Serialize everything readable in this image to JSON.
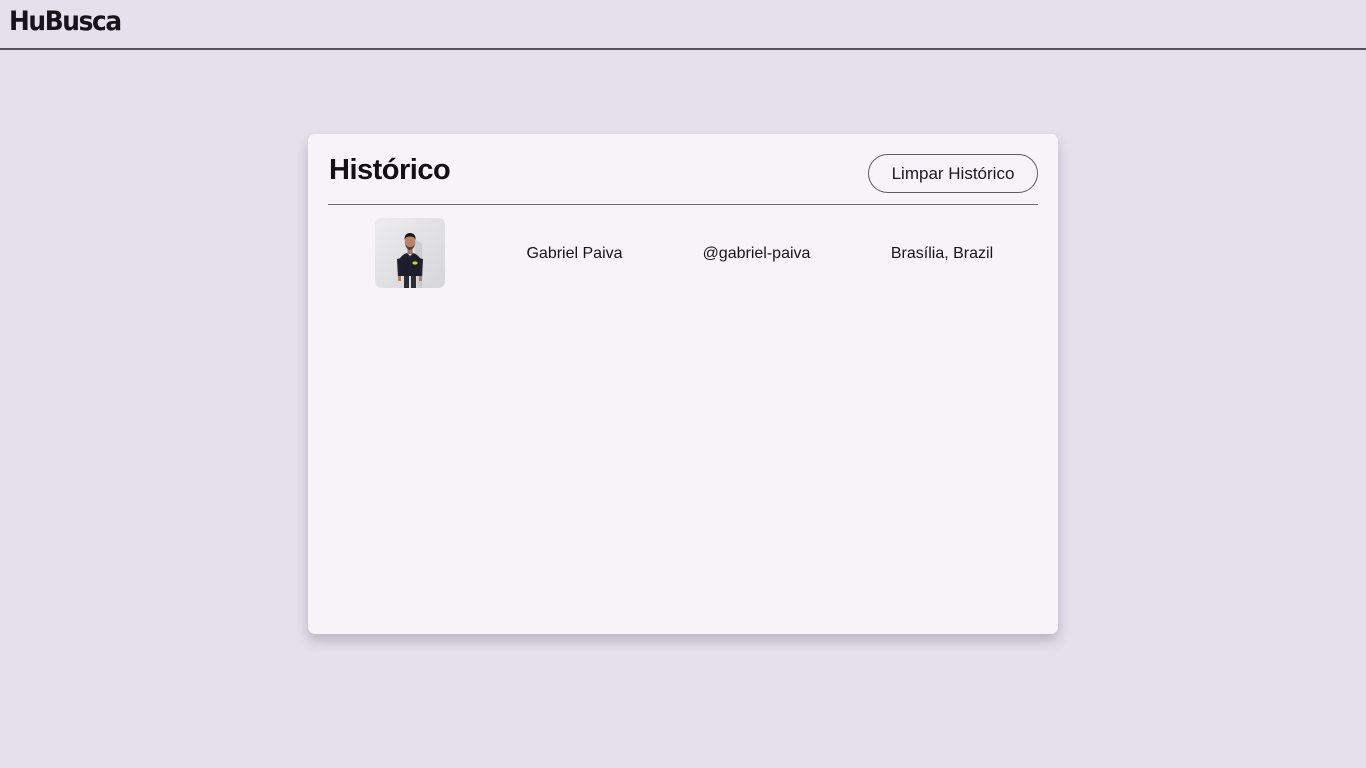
{
  "header": {
    "logo": "HuBusca"
  },
  "history": {
    "title": "Histórico",
    "clear_button_label": "Limpar Histórico",
    "items": [
      {
        "name": "Gabriel Paiva",
        "login": "@gabriel-paiva",
        "location": "Brasília, Brazil",
        "avatar_icon": "user-photo"
      }
    ]
  }
}
